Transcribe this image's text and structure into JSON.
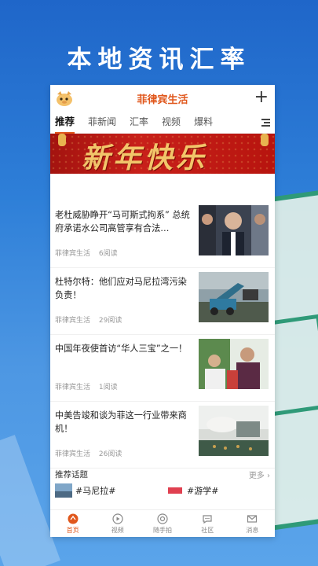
{
  "headline": "本地资讯汇率",
  "app": {
    "title": "菲律宾生活"
  },
  "tabs": [
    {
      "label": "推荐",
      "active": true
    },
    {
      "label": "菲新闻",
      "active": false
    },
    {
      "label": "汇率",
      "active": false
    },
    {
      "label": "视频",
      "active": false
    },
    {
      "label": "爆料",
      "active": false
    }
  ],
  "banner": {
    "text": "新年快乐"
  },
  "news": [
    {
      "title": "老杜威胁睁开“马可斯式拘系” 总统府承诺水公司高管享有合法…",
      "source": "菲律宾生活",
      "reads": "6阅读"
    },
    {
      "title": "杜特尔特：他们应对马尼拉湾污染负责！",
      "source": "菲律宾生活",
      "reads": "29阅读"
    },
    {
      "title": "中国年夜使首访“华人三宝”之一！",
      "source": "菲律宾生活",
      "reads": "1阅读"
    },
    {
      "title": "中美告竣和谈为菲这一行业带来商机！",
      "source": "菲律宾生活",
      "reads": "26阅读"
    }
  ],
  "topics": {
    "label": "推荐话题",
    "more": "更多",
    "items": [
      "#马尼拉#",
      "#游学#"
    ]
  },
  "bottom_nav": [
    {
      "label": "首页",
      "icon": "home-icon",
      "active": true
    },
    {
      "label": "视频",
      "icon": "video-icon",
      "active": false
    },
    {
      "label": "随手拍",
      "icon": "camera-icon",
      "active": false
    },
    {
      "label": "社区",
      "icon": "community-icon",
      "active": false
    },
    {
      "label": "消息",
      "icon": "message-icon",
      "active": false
    }
  ],
  "colors": {
    "accent": "#e0571c",
    "sky": "#2e7fd8"
  }
}
